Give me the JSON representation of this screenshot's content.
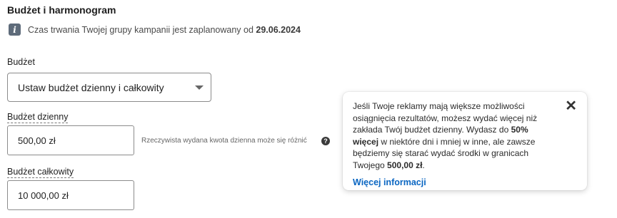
{
  "section": {
    "title": "Budżet i harmonogram"
  },
  "info": {
    "icon": "info-icon",
    "text": "Czas trwania Twojej grupy kampanii jest zaplanowany od",
    "date": "29.06.2024"
  },
  "budget": {
    "label": "Budżet",
    "selected": "Ustaw budżet dzienny i całkowity"
  },
  "daily": {
    "label": "Budżet dzienny",
    "value": "500,00 zł",
    "hint": "Rzeczywista wydana kwota dzienna może się różnić",
    "help_icon": "?"
  },
  "total": {
    "label": "Budżet całkowity",
    "value": "10 000,00 zł"
  },
  "tooltip": {
    "text_1": "Jeśli Twoje reklamy mają większe możliwości osiągnięcia rezultatów, możesz wydać więcej niż zakłada Twój budżet dzienny. Wydasz do",
    "bold_1": "50% więcej",
    "text_2": "w niektóre dni i mniej w inne, ale zawsze będziemy się starać wydać środki w granicach Twojego",
    "bold_2": "500,00 zł",
    "text_3": ".",
    "link": "Więcej informacji",
    "close": "✕"
  },
  "colors": {
    "link": "#0a66c2",
    "info_icon_bg": "#5e6b7a"
  }
}
